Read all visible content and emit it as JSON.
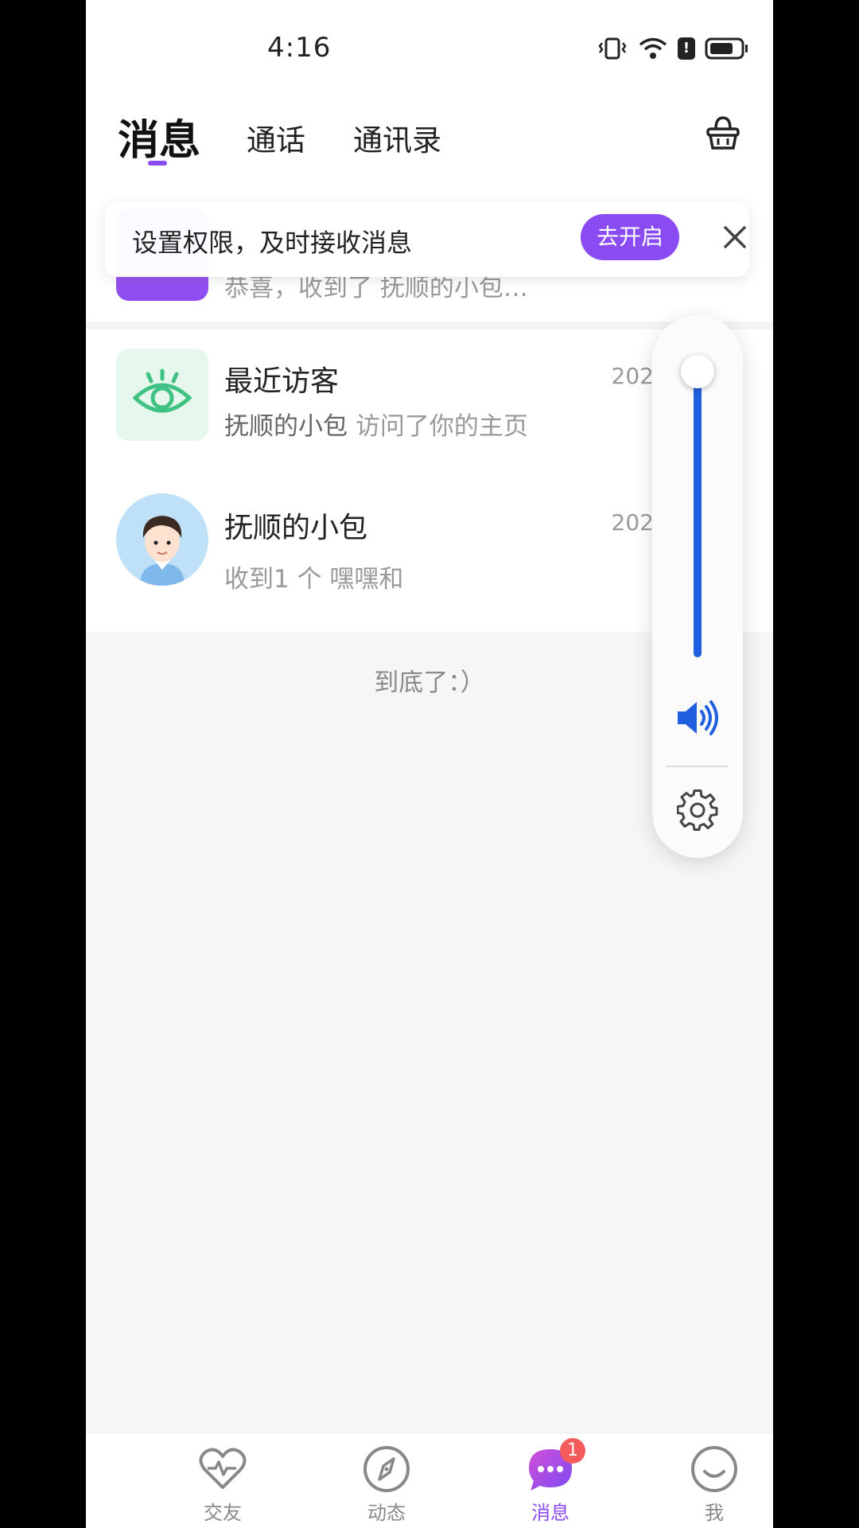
{
  "status_bar": {
    "time": "4:16",
    "icons": [
      "vibrate-icon",
      "wifi-icon",
      "alert-icon",
      "battery-icon"
    ]
  },
  "header": {
    "tabs": [
      {
        "label": "消息",
        "active": true
      },
      {
        "label": "通话",
        "active": false
      },
      {
        "label": "通讯录",
        "active": false
      }
    ],
    "right_icon": "basket-icon"
  },
  "banner": {
    "text": "设置权限，及时接收消息",
    "button_label": "去开启",
    "close_icon": "close-icon"
  },
  "messages": [
    {
      "title": "",
      "subtitle": "恭喜，收到了 抚顺的小包…",
      "time": ""
    },
    {
      "title": "最近访客",
      "subtitle_strong": "抚顺的小包",
      "subtitle": " 访问了你的主页",
      "time": "202"
    },
    {
      "title": "抚顺的小包",
      "subtitle": "收到1 个 嘿嘿和",
      "time": "202"
    }
  ],
  "list_end": "到底了：）",
  "volume_panel": {
    "level": 1.0,
    "speaker_icon": "speaker-icon",
    "settings_icon": "gear-icon"
  },
  "bottom_nav": [
    {
      "label": "交友",
      "icon": "heartbeat-icon",
      "active": false
    },
    {
      "label": "动态",
      "icon": "compass-icon",
      "active": false
    },
    {
      "label": "消息",
      "icon": "chat-bubble-icon",
      "active": true,
      "badge": "1"
    },
    {
      "label": "我",
      "icon": "smile-icon",
      "active": false
    }
  ],
  "colors": {
    "accent": "#8b4bf2",
    "volume": "#1f5fe0",
    "badge": "#f55b5b"
  }
}
